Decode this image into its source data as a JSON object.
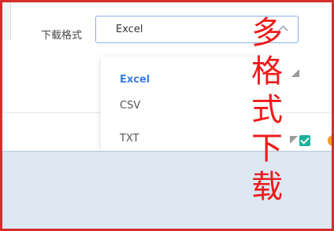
{
  "form": {
    "label": "下载格式",
    "select_value": "Excel"
  },
  "dropdown": {
    "options": [
      {
        "label": "Excel",
        "selected": true
      },
      {
        "label": "CSV",
        "selected": false
      },
      {
        "label": "TXT",
        "selected": false
      }
    ]
  },
  "annotation": {
    "chars": [
      "多",
      "格",
      "式",
      "下",
      "载"
    ],
    "color": "#ee1b1b"
  },
  "colors": {
    "accent": "#3b7fe0",
    "frame": "#d62d2d",
    "panel": "#dde8f3"
  }
}
